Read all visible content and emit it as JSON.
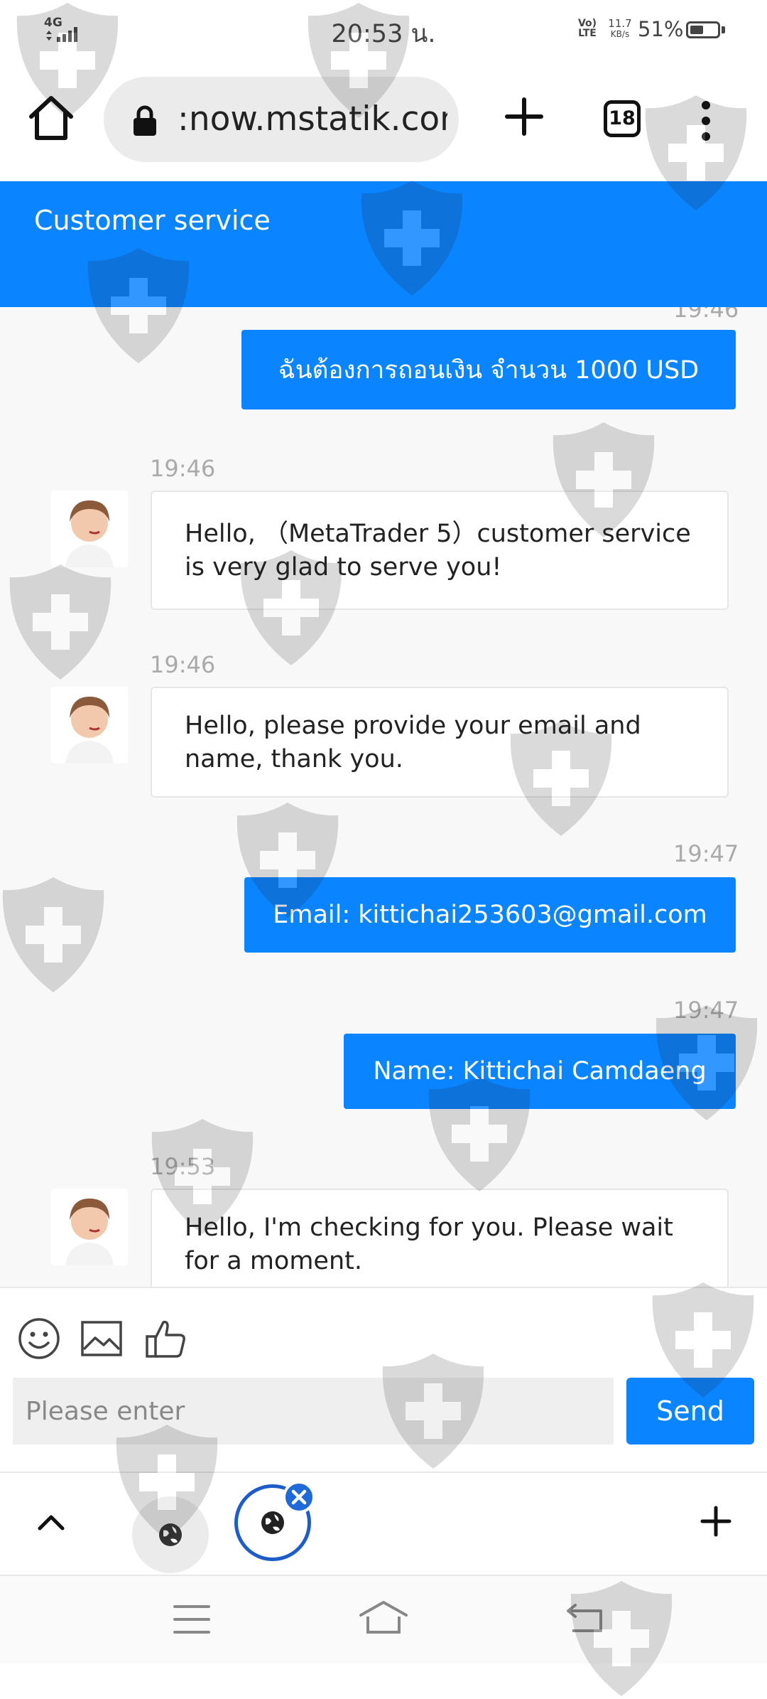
{
  "status_bar": {
    "network": "4G",
    "time": "20:53 น.",
    "volte": "Vo) LTE",
    "speed_value": "11.7",
    "speed_unit": "KB/s",
    "battery_percent": "51%",
    "battery_level": 0.51
  },
  "browser": {
    "url": ":now.mstatik.com",
    "tab_count": "18"
  },
  "header": {
    "title": "Customer service"
  },
  "chat": {
    "partial_timestamp": "19:46",
    "messages": [
      {
        "direction": "out",
        "text": "ฉันต้องการถอนเงิน จำนวน 1000 USD"
      },
      {
        "direction": "in",
        "time": "19:46",
        "text": "Hello, （MetaTrader 5）customer service is very glad to serve you!"
      },
      {
        "direction": "in",
        "time": "19:46",
        "text": "Hello, please provide your email and name, thank you."
      },
      {
        "direction": "out",
        "time": "19:47",
        "text": "Email: kittichai253603@gmail.com"
      },
      {
        "direction": "out",
        "time": "19:47",
        "text": "Name: Kittichai Camdaeng"
      },
      {
        "direction": "in",
        "time": "19:53",
        "text": "Hello, I'm checking for you. Please wait for a moment."
      }
    ]
  },
  "composer": {
    "placeholder": "Please enter",
    "send_label": "Send",
    "tools": [
      "smiley-icon",
      "image-icon",
      "thumbs-up-icon"
    ]
  },
  "colors": {
    "accent": "#0a84ff",
    "chat_background": "#f8f8f8"
  }
}
